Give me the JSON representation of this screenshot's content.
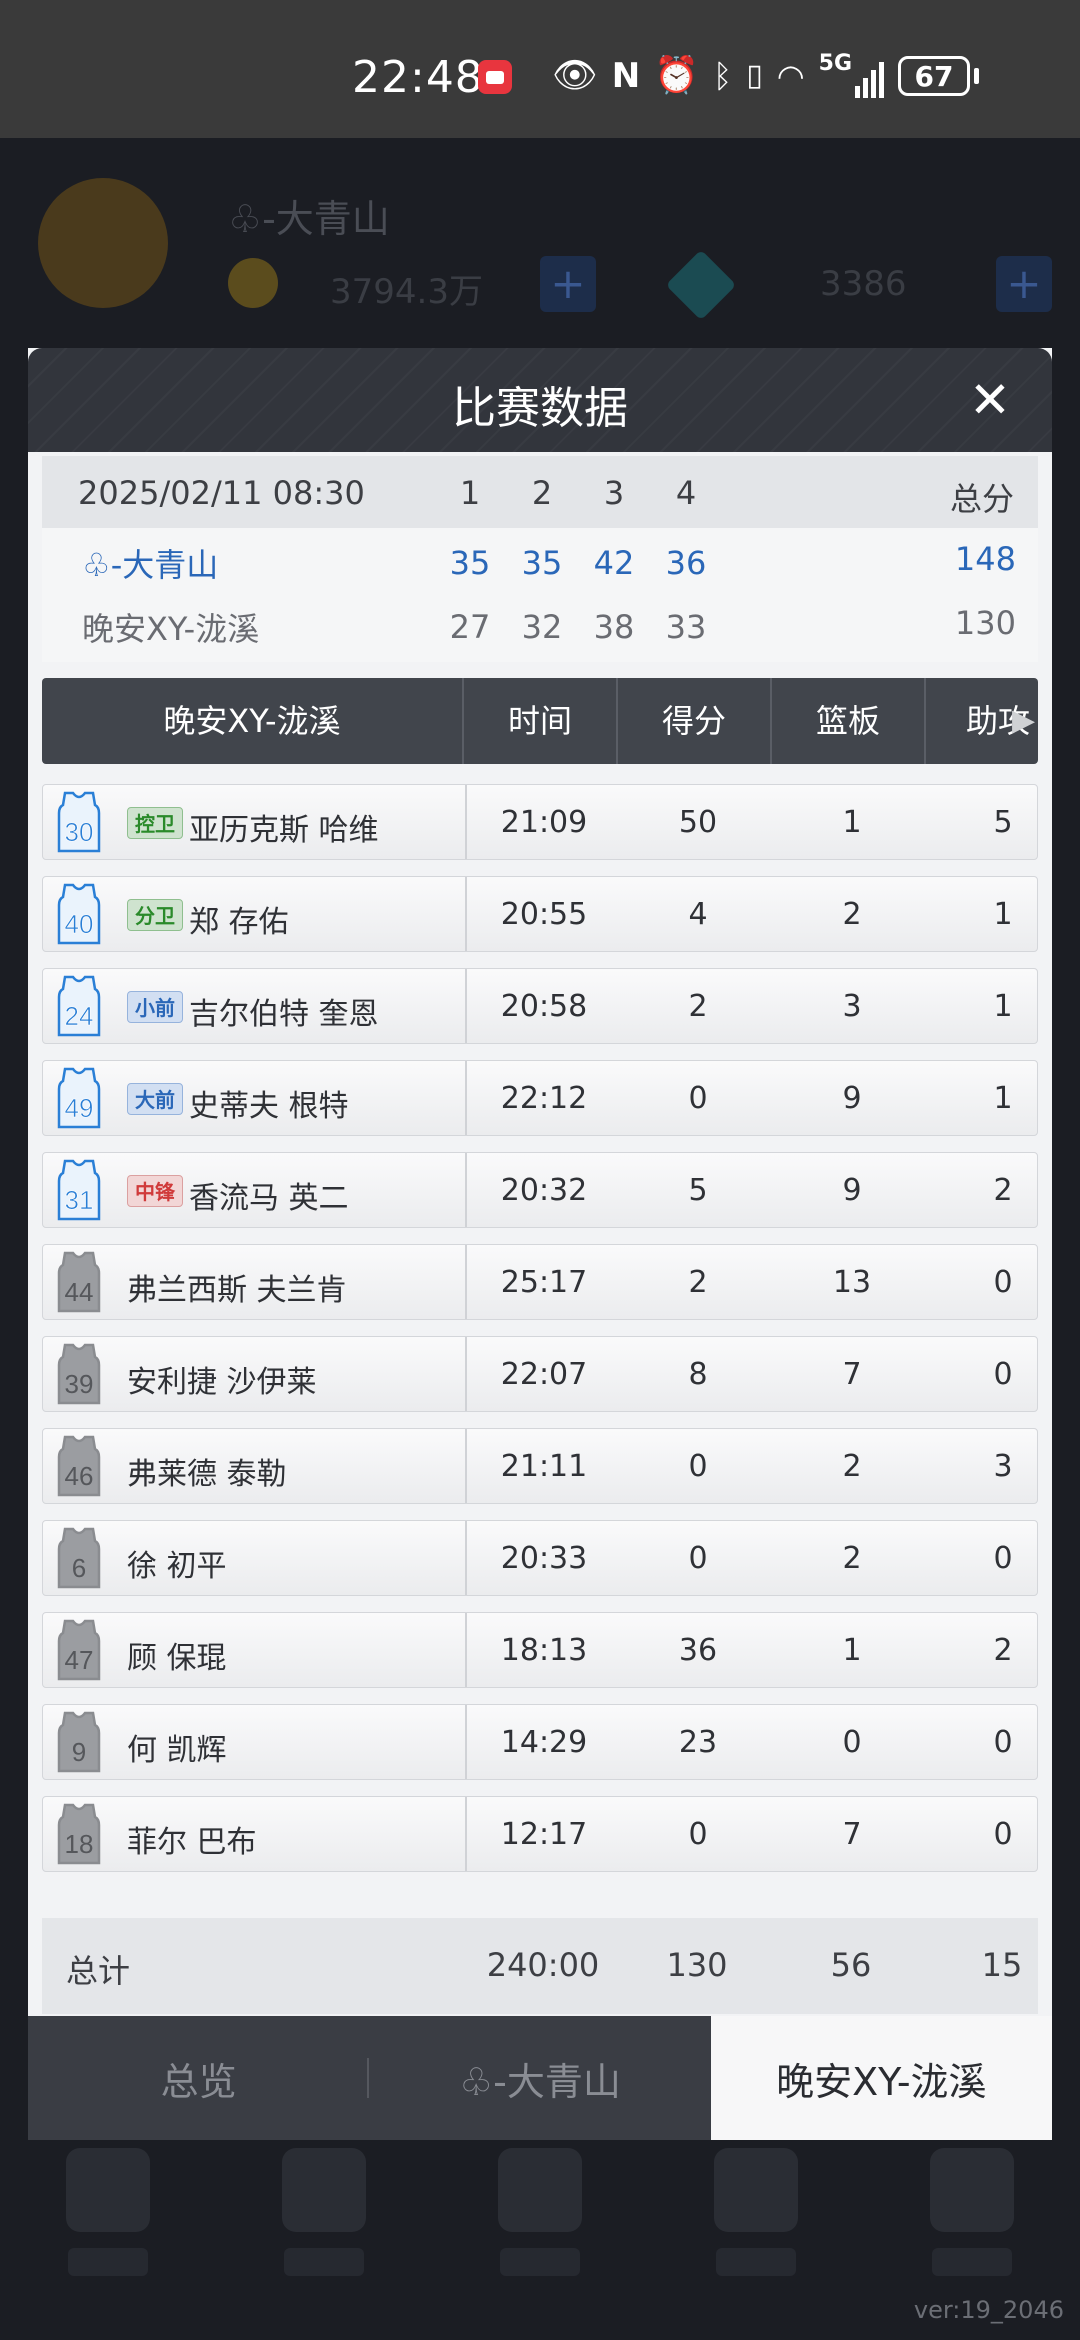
{
  "status_bar": {
    "time": "22:48",
    "battery": "67",
    "network": "5G",
    "icons": [
      "app-notification-icon",
      "eye-icon",
      "nfc-icon",
      "alarm-icon",
      "bluetooth-icon",
      "vibrate-icon",
      "wifi-icon",
      "signal-icon",
      "battery-icon"
    ]
  },
  "background": {
    "player_name": "♧-大青山",
    "gold": "3794.3万",
    "diamond": "3386",
    "version": "ver:19_2046"
  },
  "modal": {
    "title": "比赛数据",
    "close": "✕"
  },
  "scoreboard": {
    "date": "2025/02/11 08:30",
    "quarters": [
      "1",
      "2",
      "3",
      "4"
    ],
    "total_label": "总分",
    "team_a": {
      "name": "♧-大青山",
      "scores": [
        "35",
        "35",
        "42",
        "36"
      ],
      "total": "148"
    },
    "team_b": {
      "name": "晚安XY-泷溪",
      "scores": [
        "27",
        "32",
        "38",
        "33"
      ],
      "total": "130"
    }
  },
  "stats_table": {
    "team_header": "晚安XY-泷溪",
    "columns": [
      "时间",
      "得分",
      "篮板",
      "助攻"
    ],
    "rows": [
      {
        "number": "30",
        "position": "控卫",
        "pos_color": "green",
        "name": "亚历克斯 哈维",
        "time": "21:09",
        "points": "50",
        "rebounds": "1",
        "assists": "5",
        "starter": true
      },
      {
        "number": "40",
        "position": "分卫",
        "pos_color": "green",
        "name": "郑 存佑",
        "time": "20:55",
        "points": "4",
        "rebounds": "2",
        "assists": "1",
        "starter": true
      },
      {
        "number": "24",
        "position": "小前",
        "pos_color": "blue",
        "name": "吉尔伯特 奎恩",
        "time": "20:58",
        "points": "2",
        "rebounds": "3",
        "assists": "1",
        "starter": true
      },
      {
        "number": "49",
        "position": "大前",
        "pos_color": "blue",
        "name": "史蒂夫 根特",
        "time": "22:12",
        "points": "0",
        "rebounds": "9",
        "assists": "1",
        "starter": true
      },
      {
        "number": "31",
        "position": "中锋",
        "pos_color": "red",
        "name": "香流马 英二",
        "time": "20:32",
        "points": "5",
        "rebounds": "9",
        "assists": "2",
        "starter": true
      },
      {
        "number": "44",
        "position": "",
        "pos_color": "",
        "name": "弗兰西斯 夫兰肯",
        "time": "25:17",
        "points": "2",
        "rebounds": "13",
        "assists": "0",
        "starter": false
      },
      {
        "number": "39",
        "position": "",
        "pos_color": "",
        "name": "安利捷 沙伊莱",
        "time": "22:07",
        "points": "8",
        "rebounds": "7",
        "assists": "0",
        "starter": false
      },
      {
        "number": "46",
        "position": "",
        "pos_color": "",
        "name": "弗莱德 泰勒",
        "time": "21:11",
        "points": "0",
        "rebounds": "2",
        "assists": "3",
        "starter": false
      },
      {
        "number": "6",
        "position": "",
        "pos_color": "",
        "name": "徐 初平",
        "time": "20:33",
        "points": "0",
        "rebounds": "2",
        "assists": "0",
        "starter": false
      },
      {
        "number": "47",
        "position": "",
        "pos_color": "",
        "name": "顾 保琨",
        "time": "18:13",
        "points": "36",
        "rebounds": "1",
        "assists": "2",
        "starter": false
      },
      {
        "number": "9",
        "position": "",
        "pos_color": "",
        "name": "何 凯辉",
        "time": "14:29",
        "points": "23",
        "rebounds": "0",
        "assists": "0",
        "starter": false
      },
      {
        "number": "18",
        "position": "",
        "pos_color": "",
        "name": "菲尔 巴布",
        "time": "12:17",
        "points": "0",
        "rebounds": "7",
        "assists": "0",
        "starter": false
      }
    ],
    "totals": {
      "label": "总计",
      "time": "240:00",
      "points": "130",
      "rebounds": "56",
      "assists": "15"
    }
  },
  "tabs": [
    {
      "label": "总览",
      "active": false
    },
    {
      "label": "♧-大青山",
      "active": false
    },
    {
      "label": "晚安XY-泷溪",
      "active": true
    }
  ],
  "colors": {
    "team_a": "#2a67b8",
    "starter_jersey": "#2a7fd6",
    "bench_jersey": "#8a8c90",
    "header_bg": "#32353c"
  }
}
